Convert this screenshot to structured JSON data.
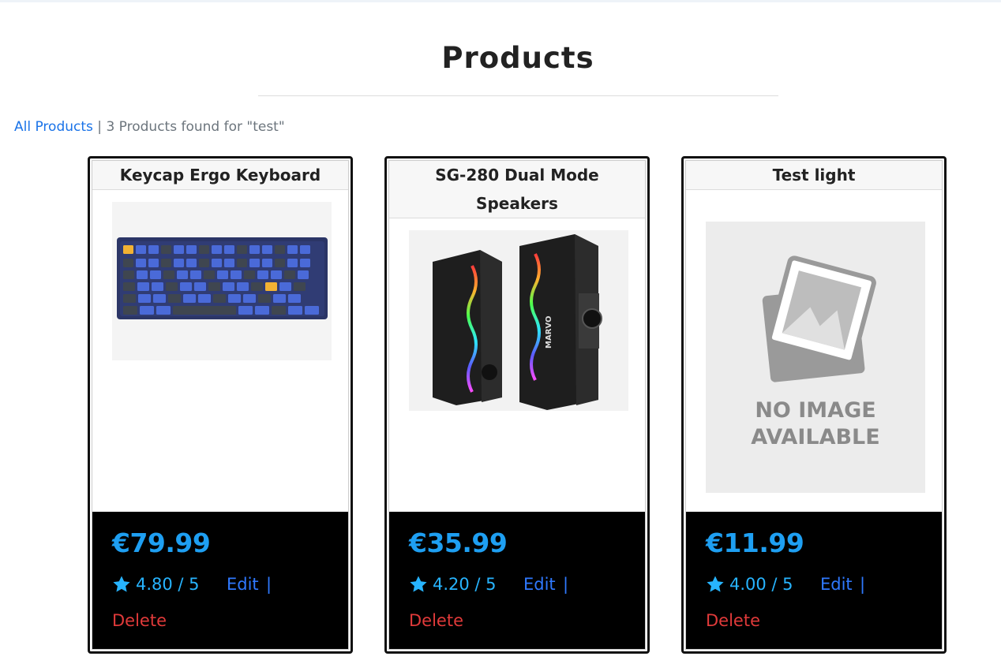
{
  "page": {
    "title": "Products"
  },
  "breadcrumb": {
    "link_label": "All Products",
    "separator": "|",
    "summary": "3 Products found for \"test\""
  },
  "products": [
    {
      "name": "Keycap Ergo Keyboard",
      "price": "€79.99",
      "rating": "4.80 / 5",
      "edit_label": "Edit",
      "separator": "|",
      "delete_label": "Delete",
      "image": "keyboard"
    },
    {
      "name": "SG-280 Dual Mode Speakers",
      "price": "€35.99",
      "rating": "4.20 / 5",
      "edit_label": "Edit",
      "separator": "|",
      "delete_label": "Delete",
      "image": "speakers",
      "brand_text": "MARVO"
    },
    {
      "name": "Test light",
      "price": "€11.99",
      "rating": "4.00 / 5",
      "edit_label": "Edit",
      "separator": "|",
      "delete_label": "Delete",
      "image": "no-image",
      "placeholder_line1": "NO IMAGE",
      "placeholder_line2": "AVAILABLE"
    }
  ],
  "colors": {
    "price": "#1e9ff2",
    "rating": "#27b4ff",
    "edit": "#2f79ff",
    "delete": "#e03a3a",
    "footer_bg": "#000000"
  }
}
